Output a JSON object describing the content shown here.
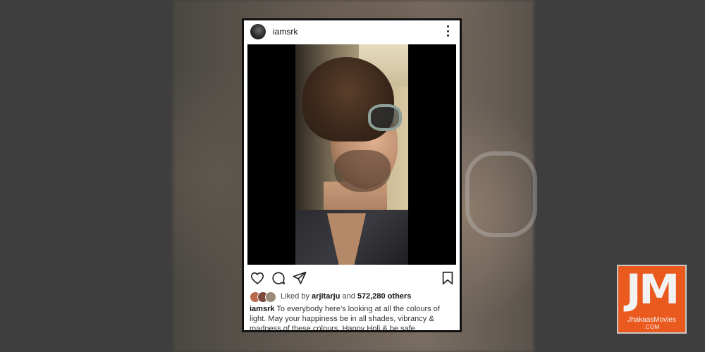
{
  "post": {
    "username": "iamsrk",
    "menu_icon": "more-vertical-icon",
    "photo_description_icon": "post-photo",
    "actions": {
      "like_icon": "heart-icon",
      "comment_icon": "comment-icon",
      "share_icon": "send-icon",
      "save_icon": "bookmark-icon"
    },
    "likes": {
      "prefix": "Liked by",
      "liker": "arjitarju",
      "joiner": "and",
      "others": "572,280 others"
    },
    "caption": {
      "author": "iamsrk",
      "text": "To everybody here’s looking at all the colours of light. May your happiness be in all shades, vibrancy & madness of these colours. Happy Holi & be safe."
    }
  },
  "watermark": {
    "letters": "JM",
    "name": "JhakaasMovies",
    "domain": ".COM",
    "color": "#ea5a1e"
  }
}
